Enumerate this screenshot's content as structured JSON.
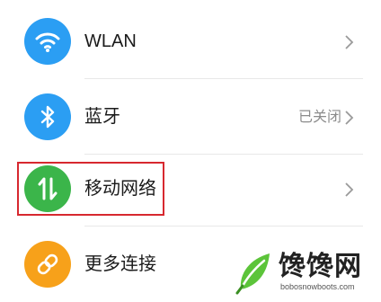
{
  "settings": {
    "items": [
      {
        "label": "WLAN",
        "status": "",
        "icon": "wifi-icon",
        "icon_color": "#2b9ef3"
      },
      {
        "label": "蓝牙",
        "status": "已关闭",
        "icon": "bluetooth-icon",
        "icon_color": "#2b9ef3"
      },
      {
        "label": "移动网络",
        "status": "",
        "icon": "mobile-data-icon",
        "icon_color": "#3bb54a"
      },
      {
        "label": "更多连接",
        "status": "",
        "icon": "link-icon",
        "icon_color": "#f7a11a"
      }
    ],
    "highlight_color": "#d7282f"
  },
  "watermark": {
    "brand": "馋馋网",
    "url": "bobosnowboots.com"
  }
}
